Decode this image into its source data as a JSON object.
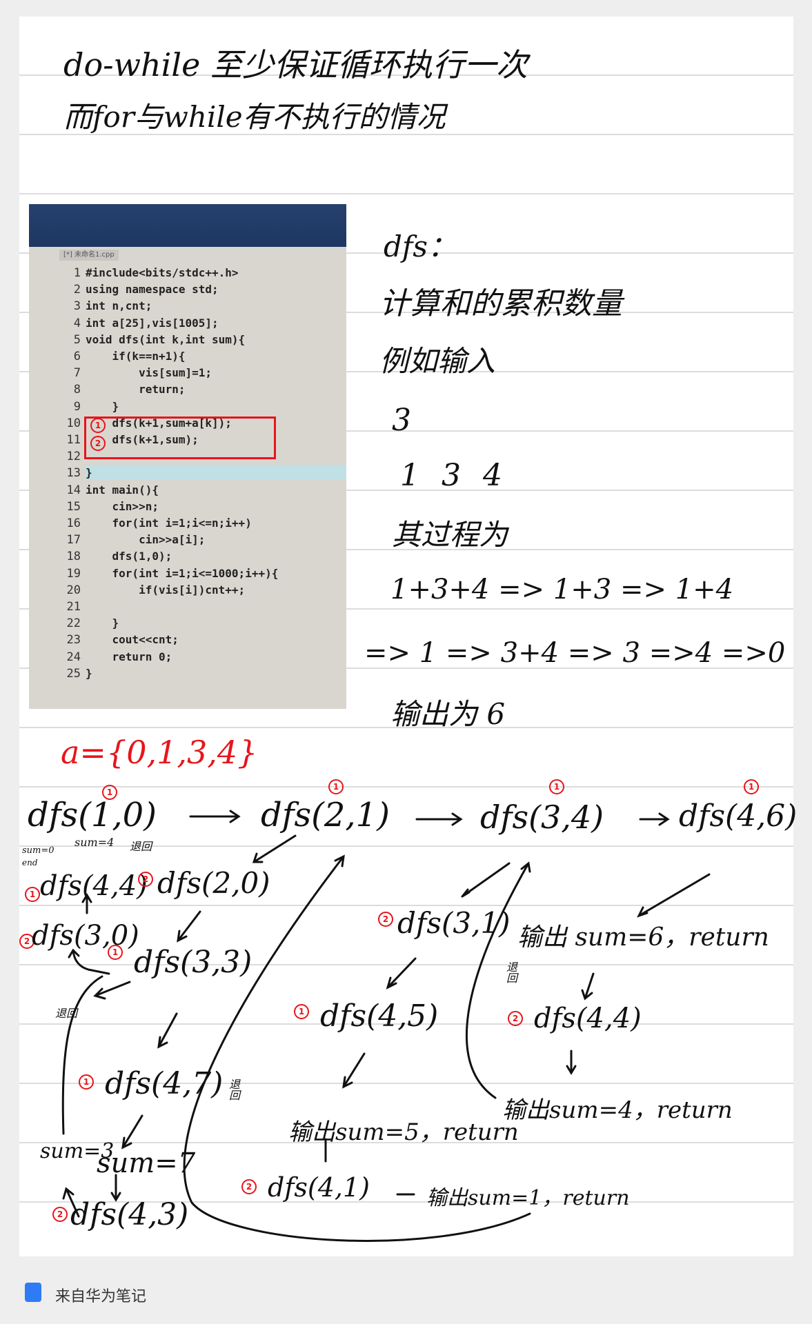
{
  "header": {
    "line1": "do-while 至少保证循环执行一次",
    "line2": "而for与while有不执行的情况"
  },
  "right_notes": {
    "title": "dfs：",
    "desc": "计算和的累积数量",
    "example": "例如输入",
    "n": "3",
    "nums": "1 3 4",
    "process_label": "其过程为",
    "seq1": "1+3+4 => 1+3 => 1+4",
    "seq2": "=> 1 => 3+4 => 3 =>4 =>0",
    "output": "输出为 6"
  },
  "code_window": {
    "tab": "[*] 未命名1.cpp",
    "lines": [
      {
        "n": "1",
        "t": "#include<bits/stdc++.h>"
      },
      {
        "n": "2",
        "t": "using namespace std;"
      },
      {
        "n": "3",
        "t": "int n,cnt;"
      },
      {
        "n": "4",
        "t": "int a[25],vis[1005];"
      },
      {
        "n": "5",
        "t": "void dfs(int k,int sum){"
      },
      {
        "n": "6",
        "t": "    if(k==n+1){"
      },
      {
        "n": "7",
        "t": "        vis[sum]=1;"
      },
      {
        "n": "8",
        "t": "        return;"
      },
      {
        "n": "9",
        "t": "    }"
      },
      {
        "n": "10",
        "t": "    dfs(k+1,sum+a[k]);"
      },
      {
        "n": "11",
        "t": "    dfs(k+1,sum);"
      },
      {
        "n": "12",
        "t": ""
      },
      {
        "n": "13",
        "t": "}"
      },
      {
        "n": "14",
        "t": "int main(){"
      },
      {
        "n": "15",
        "t": "    cin>>n;"
      },
      {
        "n": "16",
        "t": "    for(int i=1;i<=n;i++)"
      },
      {
        "n": "17",
        "t": "        cin>>a[i];"
      },
      {
        "n": "18",
        "t": "    dfs(1,0);"
      },
      {
        "n": "19",
        "t": "    for(int i=1;i<=1000;i++){"
      },
      {
        "n": "20",
        "t": "        if(vis[i])cnt++;"
      },
      {
        "n": "21",
        "t": ""
      },
      {
        "n": "22",
        "t": "    }"
      },
      {
        "n": "23",
        "t": "    cout<<cnt;"
      },
      {
        "n": "24",
        "t": "    return 0;"
      },
      {
        "n": "25",
        "t": "}"
      }
    ],
    "marks": [
      "1",
      "2"
    ]
  },
  "tree": {
    "array": "a={0,1,3,4}",
    "n1": "dfs(1,0)",
    "n2": "dfs(2,1)",
    "n3": "dfs(3,4)",
    "n4": "dfs(4,6)",
    "n5": "dfs(4,4)",
    "n6": "dfs(2,0)",
    "n7": "dfs(3,0)",
    "n8": "dfs(3,3)",
    "n9": "dfs(4,7)",
    "n10": "dfs(4,3)",
    "n11": "dfs(3,1)",
    "n12": "dfs(4,5)",
    "n13": "dfs(4,1)",
    "n14": "dfs(4,4)",
    "out6": "输出 sum=6，return",
    "out4": "输出sum=4，return",
    "out5": "输出sum=5，return",
    "out1": "输出sum=1，return",
    "sum4": "sum=4",
    "sum0": "sum=0",
    "end": "end",
    "back": "退回",
    "sum3": "sum=3",
    "sum7": "sum=7",
    "m1": "1",
    "m2": "2"
  },
  "footer": {
    "source": "来自华为笔记"
  },
  "colors": {
    "ink": "#111111",
    "red": "#e8141b",
    "paper": "#ffffff"
  }
}
